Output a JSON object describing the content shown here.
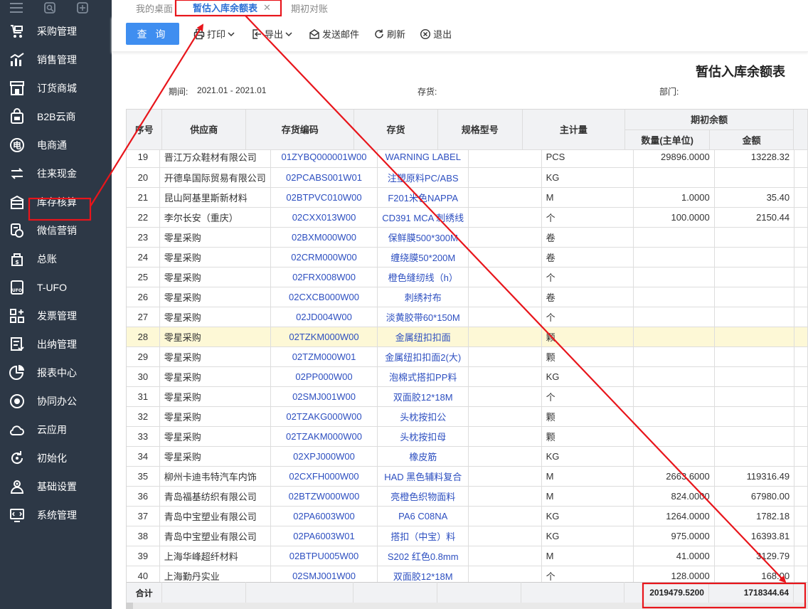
{
  "sidebar": {
    "items": [
      {
        "label": "采购管理",
        "icon": "cart-icon"
      },
      {
        "label": "销售管理",
        "icon": "chart-icon"
      },
      {
        "label": "订货商城",
        "icon": "store-icon"
      },
      {
        "label": "B2B云商",
        "icon": "bag-icon"
      },
      {
        "label": "电商通",
        "icon": "ecommerce-icon"
      },
      {
        "label": "往来现金",
        "icon": "transfer-icon"
      },
      {
        "label": "库存核算",
        "icon": "warehouse-icon"
      },
      {
        "label": "微信营销",
        "icon": "wechat-icon"
      },
      {
        "label": "总账",
        "icon": "ledger-icon"
      },
      {
        "label": "T-UFO",
        "icon": "ufo-icon"
      },
      {
        "label": "发票管理",
        "icon": "invoice-icon"
      },
      {
        "label": "出纳管理",
        "icon": "cashier-icon"
      },
      {
        "label": "报表中心",
        "icon": "pie-chart-icon"
      },
      {
        "label": "协同办公",
        "icon": "collab-icon"
      },
      {
        "label": "云应用",
        "icon": "cloud-icon"
      },
      {
        "label": "初始化",
        "icon": "init-icon"
      },
      {
        "label": "基础设置",
        "icon": "settings-icon"
      },
      {
        "label": "系统管理",
        "icon": "system-icon"
      }
    ]
  },
  "tabs": [
    {
      "label": "我的桌面"
    },
    {
      "label": "暂估入库余额表",
      "active": true
    },
    {
      "label": "期初对账"
    }
  ],
  "toolbar": {
    "query": "查 询",
    "print": "打印",
    "export": "导出",
    "send_mail": "发送邮件",
    "refresh": "刷新",
    "exit": "退出"
  },
  "report": {
    "title": "暂估入库余额表",
    "period_label": "期间:",
    "period_value": "2021.01 - 2021.01",
    "inventory_label": "存货:",
    "department_label": "部门:"
  },
  "table": {
    "headers": {
      "seq": "序号",
      "supplier": "供应商",
      "code": "存货编码",
      "item": "存货",
      "spec": "规格型号",
      "unit": "主计量",
      "opening_group": "期初余额",
      "qty": "数量(主单位)",
      "amount": "金额"
    },
    "rows": [
      {
        "seq": "19",
        "supplier": "晋江万众鞋材有限公司",
        "code": "01ZYBQ000001W00",
        "item": "WARNING LABEL",
        "spec": "",
        "unit": "PCS",
        "qty": "29896.0000",
        "amount": "13228.32"
      },
      {
        "seq": "20",
        "supplier": "开德阜国际贸易有限公司",
        "code": "02PCABS001W01",
        "item": "注塑原料PC/ABS",
        "spec": "",
        "unit": "KG",
        "qty": "",
        "amount": ""
      },
      {
        "seq": "21",
        "supplier": "昆山阿基里斯新材料",
        "code": "02BTPVC010W00",
        "item": "F201米色NAPPA",
        "spec": "",
        "unit": "M",
        "qty": "1.0000",
        "amount": "35.40"
      },
      {
        "seq": "22",
        "supplier": "李尔长安（重庆）",
        "code": "02CXX013W00",
        "item": "CD391 MCA 刺绣线",
        "spec": "",
        "unit": "个",
        "qty": "100.0000",
        "amount": "2150.44"
      },
      {
        "seq": "23",
        "supplier": "零星采购",
        "code": "02BXM000W00",
        "item": "保鲜膜500*300M",
        "spec": "",
        "unit": "卷",
        "qty": "",
        "amount": ""
      },
      {
        "seq": "24",
        "supplier": "零星采购",
        "code": "02CRM000W00",
        "item": "缠绕膜50*200M",
        "spec": "",
        "unit": "卷",
        "qty": "",
        "amount": ""
      },
      {
        "seq": "25",
        "supplier": "零星采购",
        "code": "02FRX008W00",
        "item": "橙色缝纫线（h）",
        "spec": "",
        "unit": "个",
        "qty": "",
        "amount": ""
      },
      {
        "seq": "26",
        "supplier": "零星采购",
        "code": "02CXCB000W00",
        "item": "刺绣衬布",
        "spec": "",
        "unit": "卷",
        "qty": "",
        "amount": ""
      },
      {
        "seq": "27",
        "supplier": "零星采购",
        "code": "02JD004W00",
        "item": "淡黄胶带60*150M",
        "spec": "",
        "unit": "个",
        "qty": "",
        "amount": ""
      },
      {
        "seq": "28",
        "supplier": "零星采购",
        "code": "02TZKM000W00",
        "item": "金属纽扣扣面",
        "spec": "",
        "unit": "颗",
        "qty": "",
        "amount": "",
        "highlight": true
      },
      {
        "seq": "29",
        "supplier": "零星采购",
        "code": "02TZM000W01",
        "item": "金属纽扣扣面2(大)",
        "spec": "",
        "unit": "颗",
        "qty": "",
        "amount": ""
      },
      {
        "seq": "30",
        "supplier": "零星采购",
        "code": "02PP000W00",
        "item": "泡棉式搭扣PP料",
        "spec": "",
        "unit": "KG",
        "qty": "",
        "amount": ""
      },
      {
        "seq": "31",
        "supplier": "零星采购",
        "code": "02SMJ001W00",
        "item": "双面胶12*18M",
        "spec": "",
        "unit": "个",
        "qty": "",
        "amount": ""
      },
      {
        "seq": "32",
        "supplier": "零星采购",
        "code": "02TZAKG000W00",
        "item": "头枕按扣公",
        "spec": "",
        "unit": "颗",
        "qty": "",
        "amount": ""
      },
      {
        "seq": "33",
        "supplier": "零星采购",
        "code": "02TZAKM000W00",
        "item": "头枕按扣母",
        "spec": "",
        "unit": "颗",
        "qty": "",
        "amount": ""
      },
      {
        "seq": "34",
        "supplier": "零星采购",
        "code": "02XPJ000W00",
        "item": "橡皮筋",
        "spec": "",
        "unit": "KG",
        "qty": "",
        "amount": ""
      },
      {
        "seq": "35",
        "supplier": "柳州卡迪韦特汽车内饰",
        "code": "02CXFH000W00",
        "item": "HAD 黑色辅料复合",
        "spec": "",
        "unit": "M",
        "qty": "2663.6000",
        "amount": "119316.49"
      },
      {
        "seq": "36",
        "supplier": "青岛福基纺织有限公司",
        "code": "02BTZW000W00",
        "item": "亮橙色织物面料",
        "spec": "",
        "unit": "M",
        "qty": "824.0000",
        "amount": "67980.00"
      },
      {
        "seq": "37",
        "supplier": "青岛中宝塑业有限公司",
        "code": "02PA6003W00",
        "item": "PA6 C08NA",
        "spec": "",
        "unit": "KG",
        "qty": "1264.0000",
        "amount": "1782.18"
      },
      {
        "seq": "38",
        "supplier": "青岛中宝塑业有限公司",
        "code": "02PA6003W01",
        "item": "搭扣（中宝）料",
        "spec": "",
        "unit": "KG",
        "qty": "975.0000",
        "amount": "16393.81"
      },
      {
        "seq": "39",
        "supplier": "上海华峰超纤材料",
        "code": "02BTPU005W00",
        "item": "S202 红色0.8mm",
        "spec": "",
        "unit": "M",
        "qty": "41.0000",
        "amount": "3129.79"
      },
      {
        "seq": "40",
        "supplier": "上海勤丹实业",
        "code": "02SMJ001W00",
        "item": "双面胶12*18M",
        "spec": "",
        "unit": "个",
        "qty": "128.0000",
        "amount": "168.00"
      }
    ],
    "footer": {
      "label": "合计",
      "qty_total": "2019479.5200",
      "amount_total": "1718344.64"
    }
  },
  "colors": {
    "sidebar_bg": "#2d3846",
    "accent": "#3f8ef0",
    "annotation": "#e8151b",
    "highlight_row": "#fdf8d6"
  }
}
